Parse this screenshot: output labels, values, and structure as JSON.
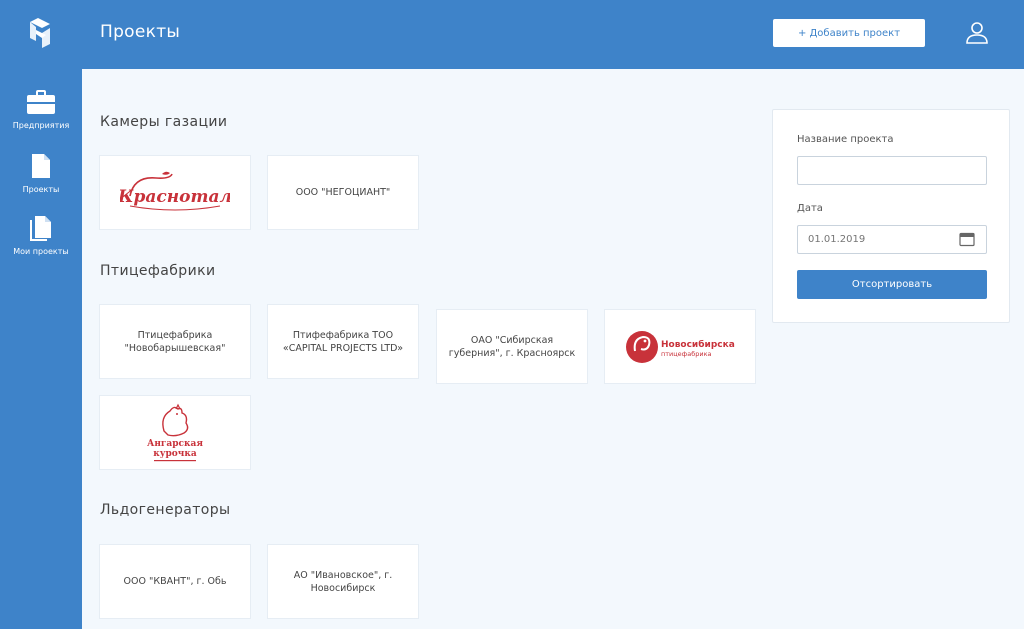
{
  "header": {
    "title": "Проекты",
    "add_button": "+ Добавить проект"
  },
  "sidebar": {
    "items": [
      {
        "label": "Предприятия",
        "icon": "briefcase-icon"
      },
      {
        "label": "Проекты",
        "icon": "file-icon"
      },
      {
        "label": "Мои проекты",
        "icon": "files-icon"
      }
    ]
  },
  "sections": [
    {
      "title": "Камеры газации",
      "cards": [
        {
          "logo": "Краснотал",
          "logo_color": "#c8323a"
        },
        {
          "text": "ООО \"НЕГОЦИАНТ\""
        }
      ]
    },
    {
      "title": "Птицефабрики",
      "cards": [
        {
          "text": "Птицефабрика \"Новобарышевская\""
        },
        {
          "text": "Птифефабрика ТОО «CAPITAL PROJECTS LTD»"
        },
        {
          "text": "ОАО \"Сибирская губерния\", г. Красноярск"
        },
        {
          "logo": "Новосибирская",
          "logo_sub": "птицефабрика",
          "logo_color": "#c8323a"
        },
        {
          "logo": "Ангарская",
          "logo_line2": "курочка",
          "logo_color": "#c8323a"
        }
      ]
    },
    {
      "title": "Льдогенераторы",
      "cards": [
        {
          "text": "ООО \"КВАНТ\", г. Обь"
        },
        {
          "text": "АО \"Ивановское\", г. Новосибирск"
        }
      ]
    }
  ],
  "filter": {
    "name_label": "Название проекта",
    "name_value": "",
    "date_label": "Дата",
    "date_placeholder": "01.01.2019",
    "sort_button": "Отсортировать"
  },
  "colors": {
    "accent": "#3e83c9",
    "background": "#f3f8fd",
    "logo_red": "#c8323a"
  }
}
